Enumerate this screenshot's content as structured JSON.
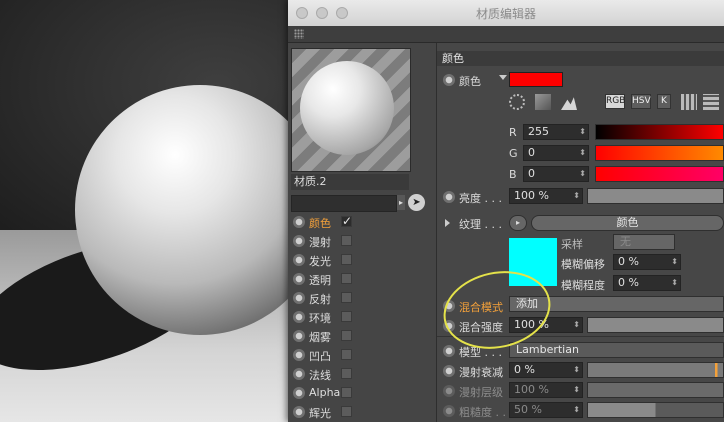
{
  "window": {
    "title": "材质编辑器"
  },
  "material": {
    "name": "材质.2"
  },
  "channels": [
    {
      "label": "颜色",
      "checked": true,
      "active": true
    },
    {
      "label": "漫射",
      "checked": false,
      "active": false
    },
    {
      "label": "发光",
      "checked": false,
      "active": false
    },
    {
      "label": "透明",
      "checked": false,
      "active": false
    },
    {
      "label": "反射",
      "checked": false,
      "active": false
    },
    {
      "label": "环境",
      "checked": false,
      "active": false
    },
    {
      "label": "烟雾",
      "checked": false,
      "active": false
    },
    {
      "label": "凹凸",
      "checked": false,
      "active": false
    },
    {
      "label": "法线",
      "checked": false,
      "active": false
    },
    {
      "label": "Alpha",
      "checked": false,
      "active": false
    },
    {
      "label": "辉光",
      "checked": false,
      "active": false
    }
  ],
  "color_section": {
    "header": "颜色",
    "color_label": "颜色",
    "swatch": "#ff0000",
    "modes": [
      "RGB",
      "HSV",
      "K"
    ],
    "r_label": "R",
    "r_value": "255",
    "g_label": "G",
    "g_value": "0",
    "b_label": "B",
    "b_value": "0",
    "brightness_label": "亮度 . . .",
    "brightness_value": "100 %",
    "texture_label": "纹理 . . .",
    "texture_button": "颜色",
    "texture_swatch": "#00ffff",
    "sampling_label": "采样",
    "sampling_value": "无",
    "blur_offset_label": "模糊偏移",
    "blur_offset_value": "0 %",
    "blur_scale_label": "模糊程度",
    "blur_scale_value": "0 %",
    "blend_mode_label": "混合模式",
    "blend_mode_value": "添加",
    "blend_strength_label": "混合强度",
    "blend_strength_value": "100 %",
    "model_label": "模型 . . .",
    "model_value": "Lambertian",
    "diffuse_falloff_label": "漫射衰减",
    "diffuse_falloff_value": "0 %",
    "diffuse_level_label": "漫射层级",
    "diffuse_level_value": "100 %",
    "roughness_label": "粗糙度 . .",
    "roughness_value": "50 %"
  },
  "colors": {
    "accent": "#f4a13a",
    "annotation": "#e4e24a"
  }
}
